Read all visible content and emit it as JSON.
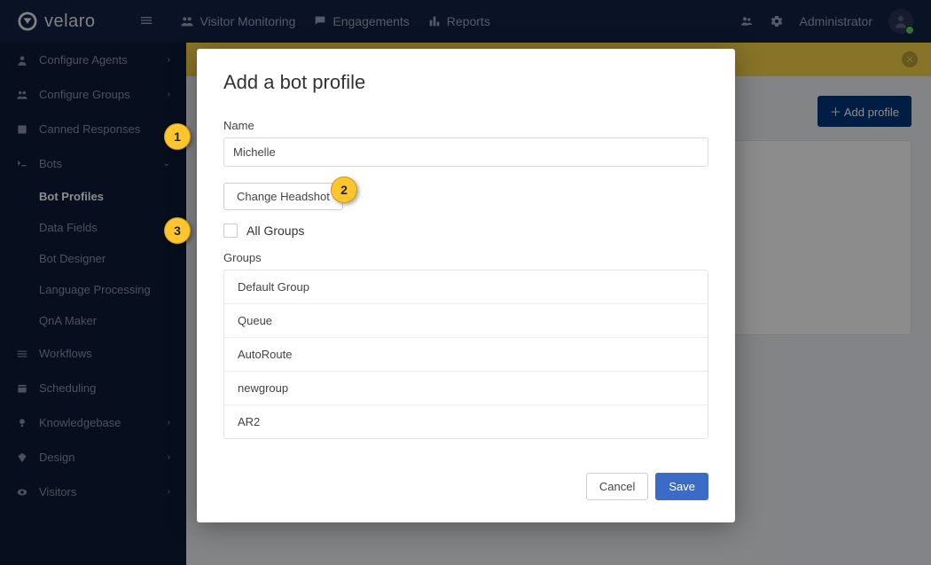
{
  "brand": "velaro",
  "topnav": {
    "visitor_monitoring": "Visitor Monitoring",
    "engagements": "Engagements",
    "reports": "Reports"
  },
  "user_label": "Administrator",
  "sidebar": {
    "configure_agents": "Configure Agents",
    "configure_groups": "Configure Groups",
    "canned_responses": "Canned Responses",
    "bots": "Bots",
    "bot_profiles": "Bot Profiles",
    "data_fields": "Data Fields",
    "bot_designer": "Bot Designer",
    "language_processing": "Language Processing",
    "qna_maker": "QnA Maker",
    "workflows": "Workflows",
    "scheduling": "Scheduling",
    "knowledgebase": "Knowledgebase",
    "design": "Design",
    "visitors": "Visitors"
  },
  "page": {
    "add_profile_btn": "Add profile"
  },
  "modal": {
    "title": "Add a bot profile",
    "name_label": "Name",
    "name_value": "Michelle",
    "change_headshot": "Change Headshot",
    "all_groups": "All Groups",
    "groups_label": "Groups",
    "groups": [
      "Default Group",
      "Queue",
      "AutoRoute",
      "newgroup",
      "AR2"
    ],
    "cancel": "Cancel",
    "save": "Save"
  },
  "callouts": {
    "one": "1",
    "two": "2",
    "three": "3"
  }
}
